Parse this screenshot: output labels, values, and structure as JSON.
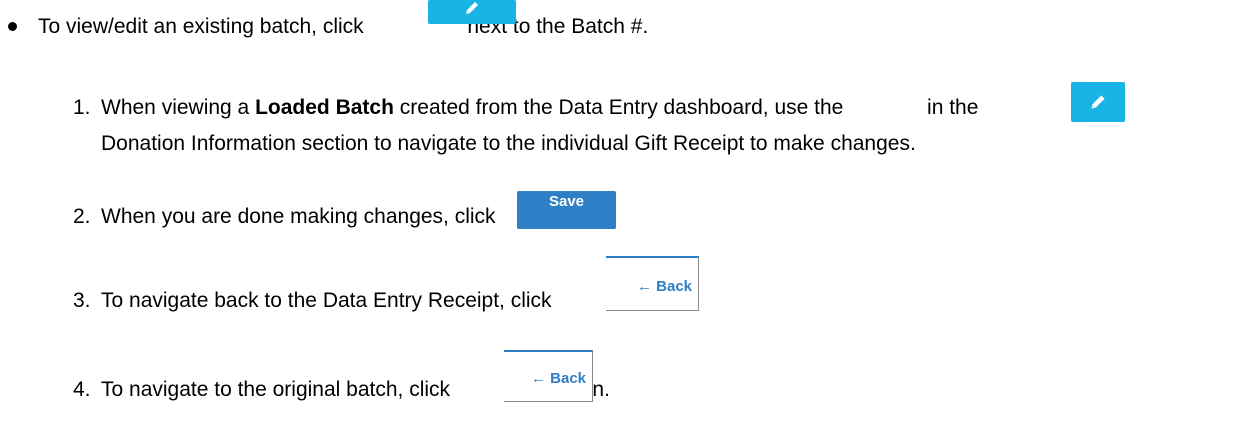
{
  "bullet": {
    "before": "To view/edit an existing batch, click ",
    "after": " next to the Batch #."
  },
  "steps": [
    {
      "number": "1.",
      "line1_before": "When viewing a ",
      "line1_bold": "Loaded Batch",
      "line1_middle": " created from the Data Entry dashboard, use the ",
      "line1_after": " in the",
      "line2": "Donation Information section to navigate to the individual Gift Receipt to make changes."
    },
    {
      "number": "2.",
      "before": "When you are done making changes, click ",
      "after": "."
    },
    {
      "number": "3.",
      "before": "To navigate back to the Data Entry Receipt, click ",
      "after": "."
    },
    {
      "number": "4.",
      "before": "To navigate to the original batch, click ",
      "after": " again."
    }
  ],
  "buttons": {
    "save_label": "Save",
    "back_arrow": "←",
    "back_label": "Back"
  },
  "icons": {
    "edit": "pencil-icon"
  },
  "colors": {
    "edit_button": "#19b4e6",
    "save_button": "#2f7fc6",
    "back_text": "#2f7fc6"
  }
}
